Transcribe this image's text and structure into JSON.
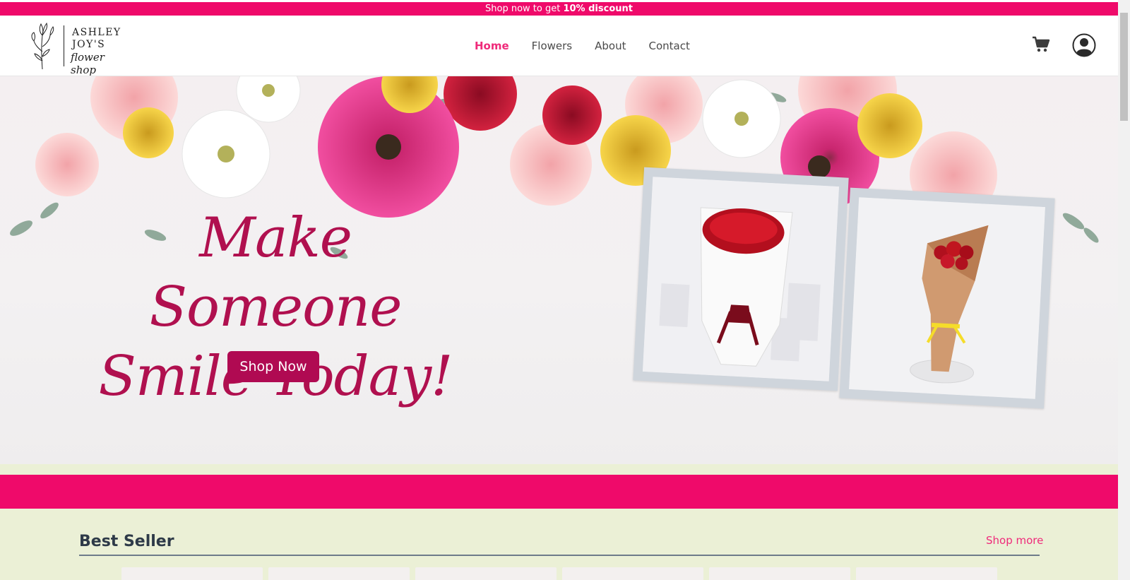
{
  "promo": {
    "text_prefix": "Shop now to get ",
    "text_bold": "10% discount"
  },
  "brand": {
    "line1": "ASHLEY",
    "line2": "JOY'S",
    "line3": "flower shop"
  },
  "nav": [
    {
      "label": "Home",
      "active": true
    },
    {
      "label": "Flowers",
      "active": false
    },
    {
      "label": "About",
      "active": false
    },
    {
      "label": "Contact",
      "active": false
    }
  ],
  "header_icons": {
    "cart": "cart-icon",
    "account": "user-circle-icon"
  },
  "hero": {
    "headline_line1": "Make Someone",
    "headline_line2": "Smile Today!",
    "cta_label": "Shop Now"
  },
  "best_seller": {
    "title": "Best Seller",
    "shop_more_label": "Shop more"
  },
  "colors": {
    "accent_pink": "#ef0a6a",
    "headline": "#b0104f",
    "cta": "#b00a52",
    "section_bg": "#ebf0d6"
  }
}
